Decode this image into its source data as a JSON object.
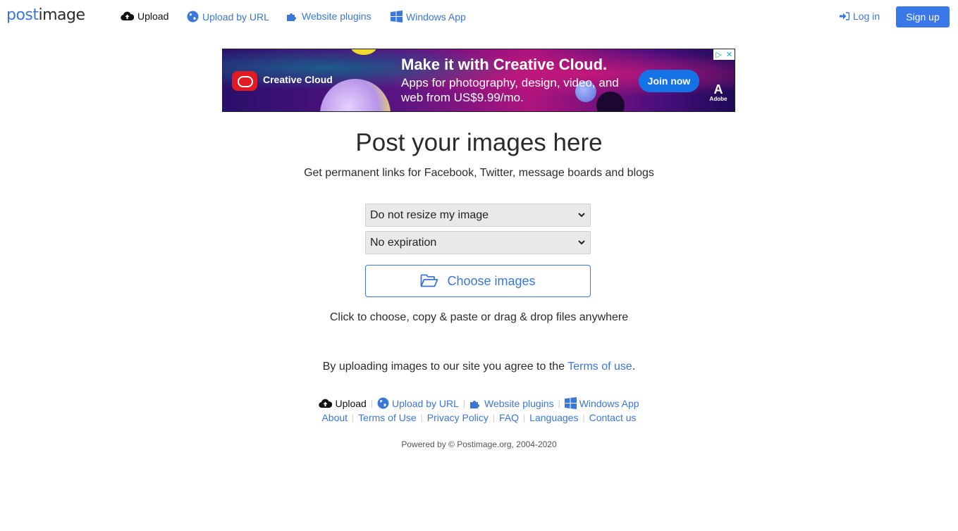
{
  "brand": {
    "logo_part1": "post",
    "logo_part2": "image",
    "accent": "#3a77d8"
  },
  "nav": {
    "items": [
      {
        "label": "Upload",
        "icon": "cloud-upload-icon",
        "active": true
      },
      {
        "label": "Upload by URL",
        "icon": "globe-icon"
      },
      {
        "label": "Website plugins",
        "icon": "puzzle-icon"
      },
      {
        "label": "Windows App",
        "icon": "windows-icon"
      }
    ],
    "login_label": "Log in",
    "signup_label": "Sign up"
  },
  "ad": {
    "brand": "Creative Cloud",
    "headline": "Make it with Creative Cloud.",
    "subline": "Apps for photography, design, video, and web from US$9.99/mo.",
    "cta": "Join now",
    "advertiser": "Adobe",
    "adchoices_icon": "▷",
    "close_icon": "✕"
  },
  "main": {
    "title": "Post your images here",
    "subtitle": "Get permanent links for Facebook, Twitter, message boards and blogs",
    "resize_select": "Do not resize my image",
    "expiration_select": "No expiration",
    "choose_button": "Choose images",
    "hint": "Click to choose, copy & paste or drag & drop files anywhere",
    "agree_prefix": "By uploading images to our site you agree to the ",
    "agree_link": "Terms of use",
    "agree_suffix": "."
  },
  "footer": {
    "row1": [
      {
        "label": "Upload",
        "icon": "cloud-upload-icon",
        "active": true
      },
      {
        "label": "Upload by URL",
        "icon": "globe-icon"
      },
      {
        "label": "Website plugins",
        "icon": "puzzle-icon"
      },
      {
        "label": "Windows App",
        "icon": "windows-icon"
      }
    ],
    "row2": [
      "About",
      "Terms of Use",
      "Privacy Policy",
      "FAQ",
      "Languages",
      "Contact us"
    ],
    "powered": "Powered by © Postimage.org, 2004-2020"
  }
}
